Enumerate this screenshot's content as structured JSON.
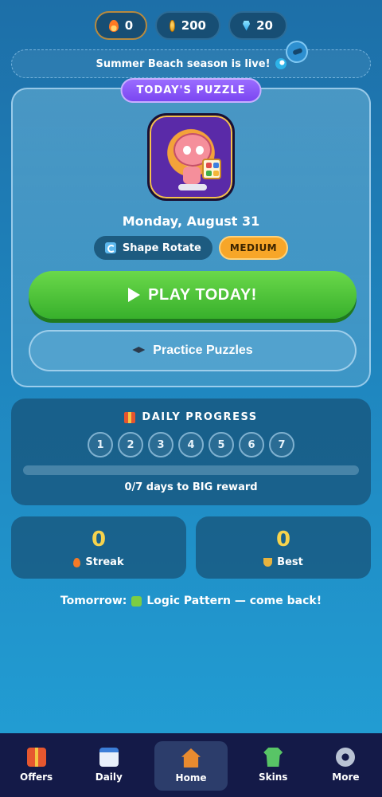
{
  "currency": {
    "flames": "0",
    "coins": "200",
    "gems": "20"
  },
  "banner": {
    "text": "Summer Beach season is live!"
  },
  "puzzle": {
    "tag": "TODAY'S PUZZLE",
    "date": "Monday, August 31",
    "type": "Shape Rotate",
    "difficulty": "MEDIUM",
    "play_label": "PLAY TODAY!",
    "practice_label": "Practice Puzzles"
  },
  "daily_progress": {
    "title": "DAILY PROGRESS",
    "days": [
      "1",
      "2",
      "3",
      "4",
      "5",
      "6",
      "7"
    ],
    "completed": 0,
    "total": 7,
    "summary": "0/7 days to BIG reward"
  },
  "stats": {
    "streak_value": "0",
    "streak_label": "Streak",
    "best_value": "0",
    "best_label": "Best"
  },
  "tomorrow": {
    "prefix": "Tomorrow:",
    "text": "Logic Pattern — come back!"
  },
  "nav": [
    {
      "label": "Offers",
      "icon": "gift-icon"
    },
    {
      "label": "Daily",
      "icon": "calendar-icon"
    },
    {
      "label": "Home",
      "icon": "house-icon",
      "active": true
    },
    {
      "label": "Skins",
      "icon": "shirt-icon"
    },
    {
      "label": "More",
      "icon": "gear-icon"
    }
  ],
  "colors": {
    "accent_purple": "#7b46f1",
    "play_green": "#38b02c",
    "difficulty_orange": "#f7a628",
    "stat_yellow": "#f6d34d",
    "nav_bg": "#141a48"
  }
}
